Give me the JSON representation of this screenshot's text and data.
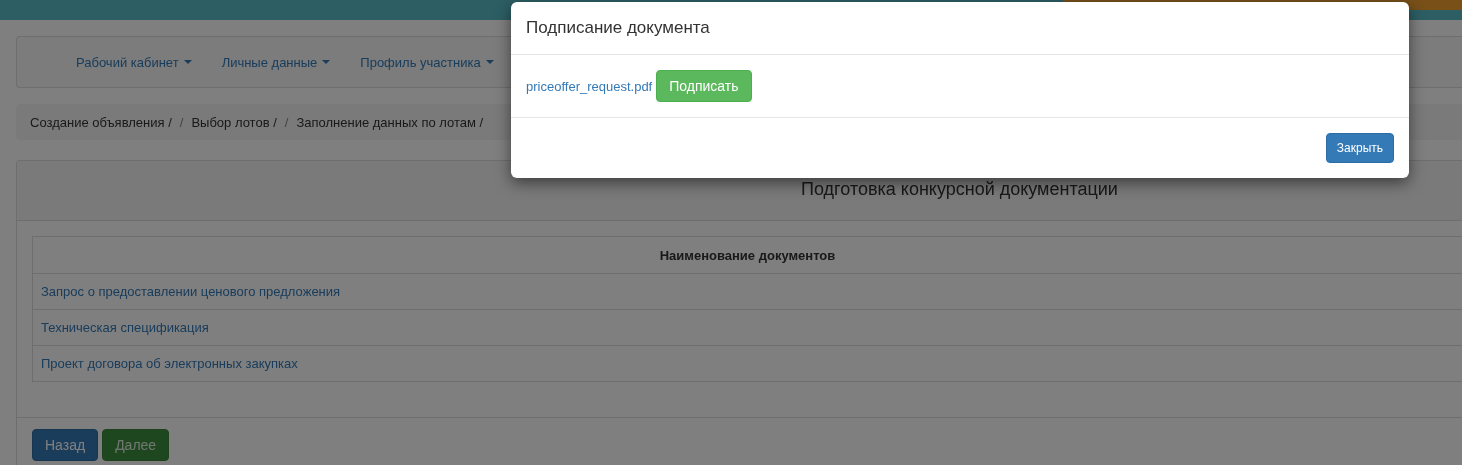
{
  "nav": {
    "items": [
      {
        "label": "Рабочий кабинет"
      },
      {
        "label": "Личные данные"
      },
      {
        "label": "Профиль участника"
      }
    ]
  },
  "breadcrumb": {
    "separator": "/",
    "items": [
      "Создание объявления /",
      "Выбор лотов /",
      "Заполнение данных по лотам /"
    ]
  },
  "panel": {
    "title": "Подготовка конкурсной документации",
    "table": {
      "columns": [
        "Наименование документов"
      ],
      "rows": [
        "Запрос о предоставлении ценового предложения",
        "Техническая спецификация",
        "Проект договора об электронных закупках"
      ]
    },
    "buttons": [
      {
        "label": "Назад",
        "kind": "primary",
        "disabled": false
      },
      {
        "label": "Далее",
        "kind": "success",
        "disabled": true
      }
    ]
  },
  "modal": {
    "title": "Подписание документа",
    "file_link": "priceoffer_request.pdf",
    "sign_button": "Подписать",
    "close_button": "Закрыть"
  }
}
